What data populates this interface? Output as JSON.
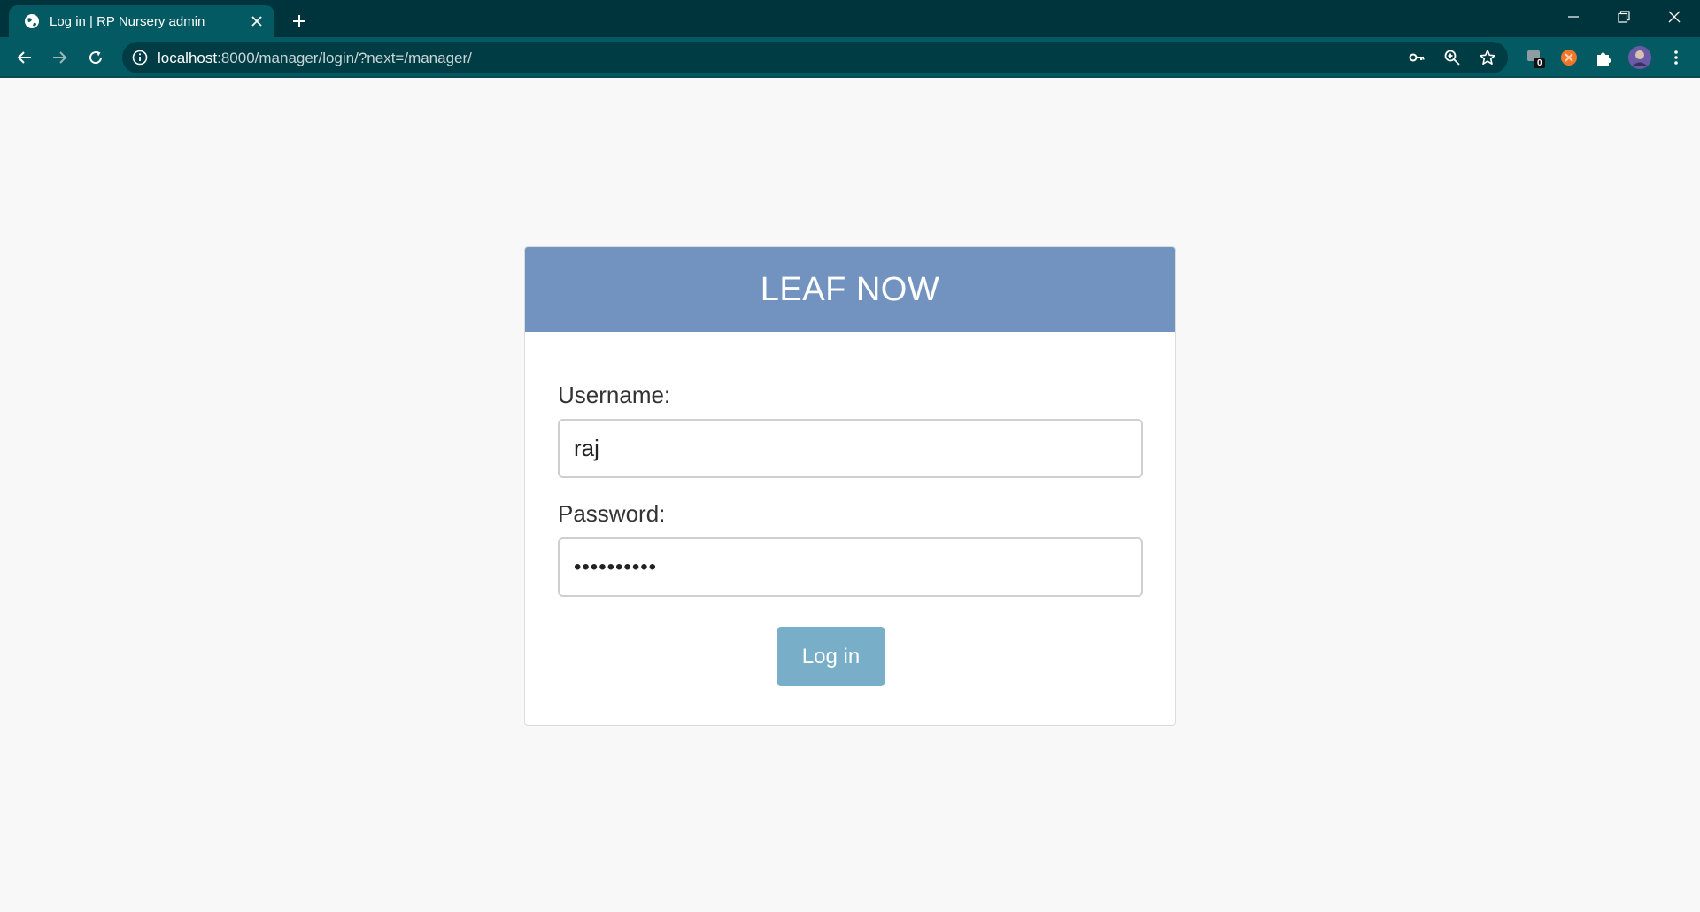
{
  "browser": {
    "tab_title": "Log in | RP Nursery admin",
    "url_host": "localhost",
    "url_rest": ":8000/manager/login/?next=/manager/",
    "extension_badge": "0"
  },
  "login": {
    "brand": "LEAF NOW",
    "username_label": "Username:",
    "username_value": "raj",
    "password_label": "Password:",
    "password_masked": "••••••••••",
    "submit_label": "Log in"
  },
  "colors": {
    "tab_strip": "#00343d",
    "toolbar": "#045a62",
    "header": "#7293c0",
    "button": "#79aec8"
  }
}
